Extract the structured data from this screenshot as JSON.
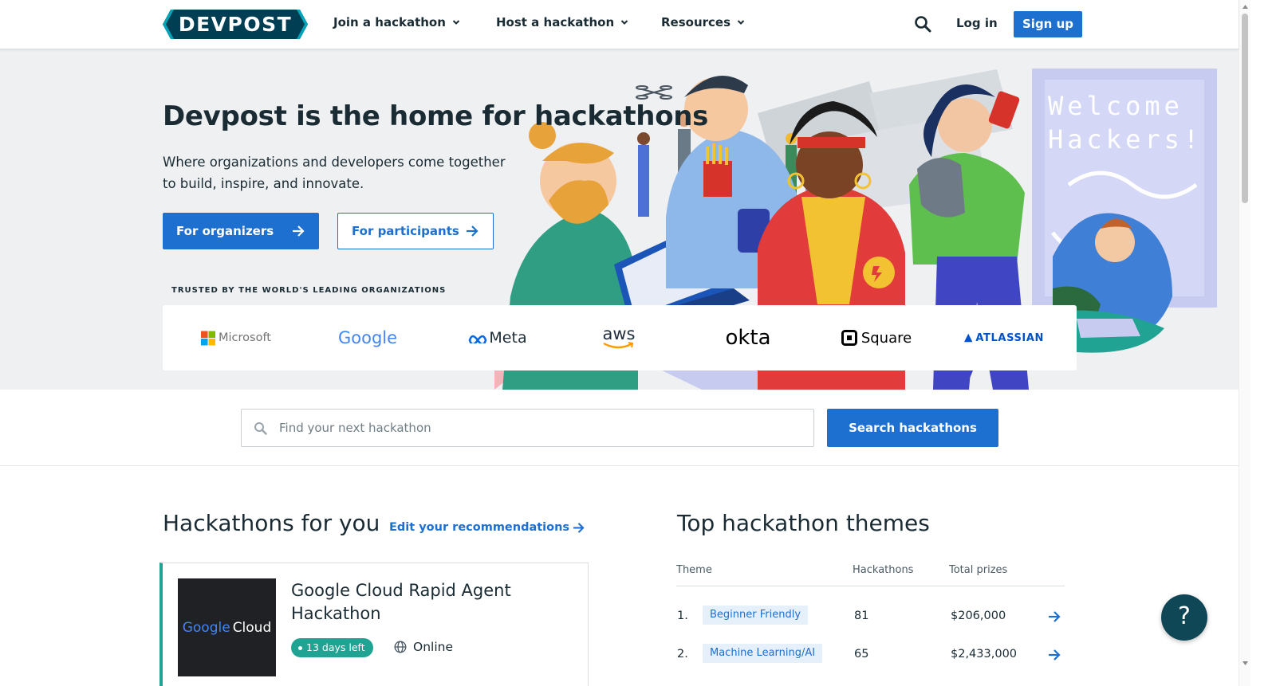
{
  "header": {
    "logo_text": "DEVPOST",
    "nav": [
      {
        "label": "Join a hackathon"
      },
      {
        "label": "Host a hackathon"
      },
      {
        "label": "Resources"
      }
    ],
    "login_label": "Log in",
    "signup_label": "Sign up"
  },
  "hero": {
    "title": "Devpost is the home for hackathons",
    "subtitle": "Where organizations and developers come together to build, inspire, and innovate.",
    "organizers_button": "For organizers",
    "participants_button": "For participants",
    "trusted_label": "TRUSTED BY THE WORLD'S LEADING ORGANIZATIONS",
    "banner_text_line1": "Welcome",
    "banner_text_line2": "Hackers!",
    "partners": [
      "Microsoft",
      "Google",
      "Meta",
      "aws",
      "okta",
      "Square",
      "ATLASSIAN"
    ]
  },
  "search": {
    "placeholder": "Find your next hackathon",
    "button_label": "Search hackathons"
  },
  "recommendations": {
    "title": "Hackathons for you",
    "edit_link": "Edit your recommendations",
    "card": {
      "thumb_brand": "Google",
      "thumb_product": "Cloud",
      "name": "Google Cloud Rapid Agent Hackathon",
      "time_left": "13 days left",
      "location": "Online"
    }
  },
  "themes": {
    "title": "Top hackathon themes",
    "columns": [
      "Theme",
      "Hackathons",
      "Total prizes"
    ],
    "rows": [
      {
        "rank": "1.",
        "theme": "Beginner Friendly",
        "hackathons": "81",
        "prizes": "$206,000"
      },
      {
        "rank": "2.",
        "theme": "Machine Learning/AI",
        "hackathons": "65",
        "prizes": "$2,433,000"
      }
    ]
  },
  "help": {
    "label": "?"
  },
  "colors": {
    "primary": "#1d6fd0",
    "dark": "#003e54",
    "teal": "#21a393",
    "help_bg": "#0f4757"
  }
}
